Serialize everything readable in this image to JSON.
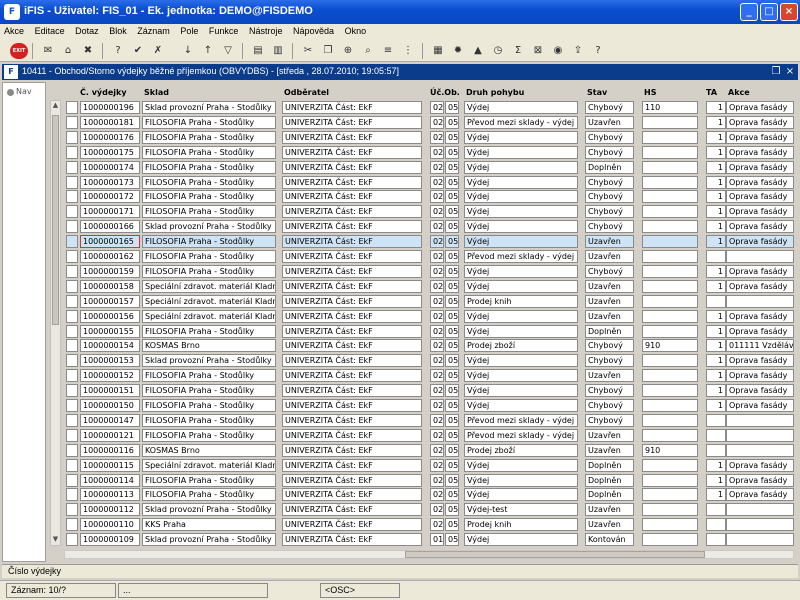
{
  "window": {
    "title": "iFIS - Uživatel: FIS_01 - Ek. jednotka: DEMO@FISDEMO",
    "logo": "iFIS"
  },
  "menu": [
    "Akce",
    "Editace",
    "Dotaz",
    "Blok",
    "Záznam",
    "Pole",
    "Funkce",
    "Nástroje",
    "Nápověda",
    "Okno"
  ],
  "toolbar": {
    "exit_label": "EXIT"
  },
  "form": {
    "title": "10411 - Obchod/Storno výdejky běžné příjemkou (OBVYDBS) - [středa , 28.07.2010; 19:05:57]",
    "logo": "F"
  },
  "nav": {
    "label": "Nav"
  },
  "columns": {
    "cislo": "Č. výdejky",
    "sklad": "Sklad",
    "odberatel": "Odběratel",
    "uc_ob": "Úč.Ob.",
    "druh": "Druh pohybu",
    "stav": "Stav",
    "hs": "HS",
    "ta": "TA",
    "akce": "Akce"
  },
  "rows": [
    {
      "cislo": "1000000196",
      "sklad": "Sklad provozní Praha - Stodůlky",
      "odberatel": "UNIVERZITA Část: EkF",
      "uc": "02",
      "ob": "05",
      "druh": "Výdej",
      "stav": "Chybový",
      "hs": "110",
      "ta": "1",
      "akce": "Oprava fasády"
    },
    {
      "cislo": "1000000181",
      "sklad": "FILOSOFIA Praha - Stodůlky",
      "odberatel": "UNIVERZITA Část: EkF",
      "uc": "02",
      "ob": "05",
      "druh": "Převod mezi sklady - výdej",
      "stav": "Uzavřen",
      "hs": "",
      "ta": "1",
      "akce": "Oprava fasády"
    },
    {
      "cislo": "1000000176",
      "sklad": "FILOSOFIA Praha - Stodůlky",
      "odberatel": "UNIVERZITA Část: EkF",
      "uc": "02",
      "ob": "05",
      "druh": "Výdej",
      "stav": "Chybový",
      "hs": "",
      "ta": "1",
      "akce": "Oprava fasády"
    },
    {
      "cislo": "1000000175",
      "sklad": "FILOSOFIA Praha - Stodůlky",
      "odberatel": "UNIVERZITA Část: EkF",
      "uc": "02",
      "ob": "05",
      "druh": "Výdej",
      "stav": "Chybový",
      "hs": "",
      "ta": "1",
      "akce": "Oprava fasády"
    },
    {
      "cislo": "1000000174",
      "sklad": "FILOSOFIA Praha - Stodůlky",
      "odberatel": "UNIVERZITA Část: EkF",
      "uc": "02",
      "ob": "05",
      "druh": "Výdej",
      "stav": "Doplněn",
      "hs": "",
      "ta": "1",
      "akce": "Oprava fasády"
    },
    {
      "cislo": "1000000173",
      "sklad": "FILOSOFIA Praha - Stodůlky",
      "odberatel": "UNIVERZITA Část: EkF",
      "uc": "02",
      "ob": "05",
      "druh": "Výdej",
      "stav": "Chybový",
      "hs": "",
      "ta": "1",
      "akce": "Oprava fasády"
    },
    {
      "cislo": "1000000172",
      "sklad": "FILOSOFIA Praha - Stodůlky",
      "odberatel": "UNIVERZITA Část: EkF",
      "uc": "02",
      "ob": "05",
      "druh": "Výdej",
      "stav": "Chybový",
      "hs": "",
      "ta": "1",
      "akce": "Oprava fasády"
    },
    {
      "cislo": "1000000171",
      "sklad": "FILOSOFIA Praha - Stodůlky",
      "odberatel": "UNIVERZITA Část: EkF",
      "uc": "02",
      "ob": "05",
      "druh": "Výdej",
      "stav": "Chybový",
      "hs": "",
      "ta": "1",
      "akce": "Oprava fasády"
    },
    {
      "cislo": "1000000166",
      "sklad": "Sklad provozní Praha - Stodůlky",
      "odberatel": "UNIVERZITA Část: EkF",
      "uc": "02",
      "ob": "05",
      "druh": "Výdej",
      "stav": "Chybový",
      "hs": "",
      "ta": "1",
      "akce": "Oprava fasády"
    },
    {
      "cislo": "1000000165",
      "sklad": "FILOSOFIA Praha - Stodůlky",
      "odberatel": "UNIVERZITA Část: EkF",
      "uc": "02",
      "ob": "05",
      "druh": "Výdej",
      "stav": "Uzavřen",
      "hs": "",
      "ta": "1",
      "akce": "Oprava fasády"
    },
    {
      "cislo": "1000000162",
      "sklad": "FILOSOFIA Praha - Stodůlky",
      "odberatel": "UNIVERZITA Část: EkF",
      "uc": "02",
      "ob": "05",
      "druh": "Převod mezi sklady - výdej",
      "stav": "Uzavřen",
      "hs": "",
      "ta": "",
      "akce": ""
    },
    {
      "cislo": "1000000159",
      "sklad": "FILOSOFIA Praha - Stodůlky",
      "odberatel": "UNIVERZITA Část: EkF",
      "uc": "02",
      "ob": "05",
      "druh": "Výdej",
      "stav": "Chybový",
      "hs": "",
      "ta": "1",
      "akce": "Oprava fasády"
    },
    {
      "cislo": "1000000158",
      "sklad": "Speciální zdravot. materiál Kladno",
      "odberatel": "UNIVERZITA Část: EkF",
      "uc": "02",
      "ob": "05",
      "druh": "Výdej",
      "stav": "Uzavřen",
      "hs": "",
      "ta": "1",
      "akce": "Oprava fasády"
    },
    {
      "cislo": "1000000157",
      "sklad": "Speciální zdravot. materiál Kladno",
      "odberatel": "UNIVERZITA Část: EkF",
      "uc": "02",
      "ob": "05",
      "druh": "Prodej knih",
      "stav": "Uzavřen",
      "hs": "",
      "ta": "",
      "akce": ""
    },
    {
      "cislo": "1000000156",
      "sklad": "Speciální zdravot. materiál Kladno",
      "odberatel": "UNIVERZITA Část: EkF",
      "uc": "02",
      "ob": "05",
      "druh": "Výdej",
      "stav": "Uzavřen",
      "hs": "",
      "ta": "1",
      "akce": "Oprava fasády"
    },
    {
      "cislo": "1000000155",
      "sklad": "FILOSOFIA Praha - Stodůlky",
      "odberatel": "UNIVERZITA Část: EkF",
      "uc": "02",
      "ob": "05",
      "druh": "Výdej",
      "stav": "Doplněn",
      "hs": "",
      "ta": "1",
      "akce": "Oprava fasády"
    },
    {
      "cislo": "1000000154",
      "sklad": "KOSMAS Brno",
      "odberatel": "UNIVERZITA Část: EkF",
      "uc": "02",
      "ob": "05",
      "druh": "Prodej zboží",
      "stav": "Chybový",
      "hs": "910",
      "ta": "1",
      "akce": "011111 Vzděláv"
    },
    {
      "cislo": "1000000153",
      "sklad": "Sklad provozní Praha - Stodůlky",
      "odberatel": "UNIVERZITA Část: EkF",
      "uc": "02",
      "ob": "05",
      "druh": "Výdej",
      "stav": "Chybový",
      "hs": "",
      "ta": "1",
      "akce": "Oprava fasády"
    },
    {
      "cislo": "1000000152",
      "sklad": "FILOSOFIA Praha - Stodůlky",
      "odberatel": "UNIVERZITA Část: EkF",
      "uc": "02",
      "ob": "05",
      "druh": "Výdej",
      "stav": "Uzavřen",
      "hs": "",
      "ta": "1",
      "akce": "Oprava fasády"
    },
    {
      "cislo": "1000000151",
      "sklad": "FILOSOFIA Praha - Stodůlky",
      "odberatel": "UNIVERZITA Část: EkF",
      "uc": "02",
      "ob": "05",
      "druh": "Výdej",
      "stav": "Chybový",
      "hs": "",
      "ta": "1",
      "akce": "Oprava fasády"
    },
    {
      "cislo": "1000000150",
      "sklad": "FILOSOFIA Praha - Stodůlky",
      "odberatel": "UNIVERZITA Část: EkF",
      "uc": "02",
      "ob": "05",
      "druh": "Výdej",
      "stav": "Chybový",
      "hs": "",
      "ta": "1",
      "akce": "Oprava fasády"
    },
    {
      "cislo": "1000000147",
      "sklad": "FILOSOFIA Praha - Stodůlky",
      "odberatel": "UNIVERZITA Část: EkF",
      "uc": "02",
      "ob": "05",
      "druh": "Převod mezi sklady - výdej",
      "stav": "Chybový",
      "hs": "",
      "ta": "",
      "akce": ""
    },
    {
      "cislo": "1000000121",
      "sklad": "FILOSOFIA Praha - Stodůlky",
      "odberatel": "UNIVERZITA Část: EkF",
      "uc": "02",
      "ob": "05",
      "druh": "Převod mezi sklady - výdej",
      "stav": "Uzavřen",
      "hs": "",
      "ta": "",
      "akce": ""
    },
    {
      "cislo": "1000000116",
      "sklad": "KOSMAS Brno",
      "odberatel": "UNIVERZITA Část: EkF",
      "uc": "02",
      "ob": "05",
      "druh": "Prodej zboží",
      "stav": "Uzavřen",
      "hs": "910",
      "ta": "",
      "akce": ""
    },
    {
      "cislo": "1000000115",
      "sklad": "Speciální zdravot. materiál Kladno",
      "odberatel": "UNIVERZITA Část: EkF",
      "uc": "02",
      "ob": "05",
      "druh": "Výdej",
      "stav": "Doplněn",
      "hs": "",
      "ta": "1",
      "akce": "Oprava fasády"
    },
    {
      "cislo": "1000000114",
      "sklad": "FILOSOFIA Praha - Stodůlky",
      "odberatel": "UNIVERZITA Část: EkF",
      "uc": "02",
      "ob": "05",
      "druh": "Výdej",
      "stav": "Doplněn",
      "hs": "",
      "ta": "1",
      "akce": "Oprava fasády"
    },
    {
      "cislo": "1000000113",
      "sklad": "FILOSOFIA Praha - Stodůlky",
      "odberatel": "UNIVERZITA Část: EkF",
      "uc": "02",
      "ob": "05",
      "druh": "Výdej",
      "stav": "Doplněn",
      "hs": "",
      "ta": "1",
      "akce": "Oprava fasády"
    },
    {
      "cislo": "1000000112",
      "sklad": "Sklad provozní Praha - Stodůlky",
      "odberatel": "UNIVERZITA Část: EkF",
      "uc": "02",
      "ob": "05",
      "druh": "Výdej-test",
      "stav": "Uzavřen",
      "hs": "",
      "ta": "",
      "akce": ""
    },
    {
      "cislo": "1000000110",
      "sklad": "KKS Praha",
      "odberatel": "UNIVERZITA Část: EkF",
      "uc": "02",
      "ob": "05",
      "druh": "Prodej knih",
      "stav": "Uzavřen",
      "hs": "",
      "ta": "",
      "akce": ""
    },
    {
      "cislo": "1000000109",
      "sklad": "Sklad provozní Praha - Stodůlky",
      "odberatel": "UNIVERZITA Část: EkF",
      "uc": "01",
      "ob": "05",
      "druh": "Výdej",
      "stav": "Kontován",
      "hs": "",
      "ta": "",
      "akce": ""
    }
  ],
  "selected_row": 9,
  "status": {
    "field_label": "Číslo výdejky",
    "record": "Záznam: 10/?",
    "dots": "...",
    "osc": "<OSC>"
  }
}
